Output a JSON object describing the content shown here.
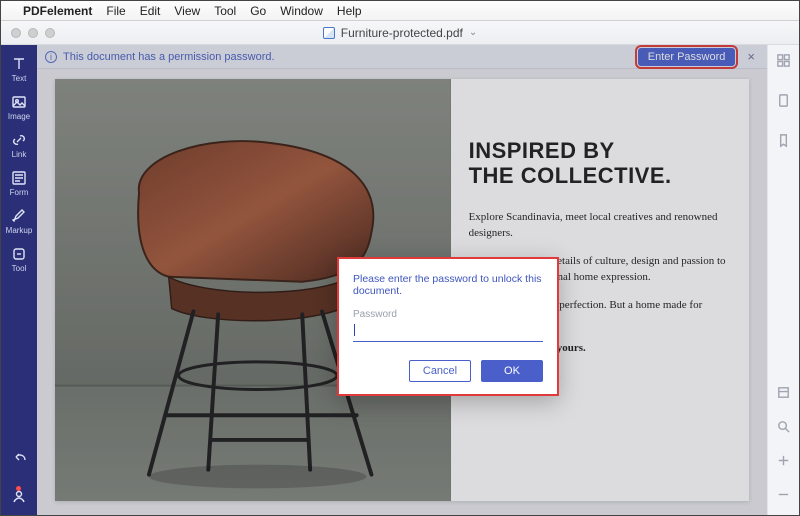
{
  "mac_menu": {
    "app": "PDFelement",
    "items": [
      "File",
      "Edit",
      "View",
      "Tool",
      "Go",
      "Window",
      "Help"
    ]
  },
  "window": {
    "doc_title": "Furniture-protected.pdf"
  },
  "sidebar": {
    "tools": [
      {
        "label": "Text",
        "icon": "text-icon"
      },
      {
        "label": "Image",
        "icon": "image-icon"
      },
      {
        "label": "Link",
        "icon": "link-icon"
      },
      {
        "label": "Form",
        "icon": "form-icon"
      },
      {
        "label": "Markup",
        "icon": "markup-icon"
      },
      {
        "label": "Tool",
        "icon": "tool-icon"
      }
    ]
  },
  "banner": {
    "message": "This document has a permission password.",
    "enter_password": "Enter Password"
  },
  "document": {
    "heading_line1": "INSPIRED BY",
    "heading_line2": "THE COLLECTIVE.",
    "para1": "Explore Scandinavia, meet local creatives and renowned designers.",
    "para2": "Be inspired by the details of culture, design and passion to find your own personal home expression.",
    "para3": "Not a space built on perfection. But a home made for living.",
    "signoff": "From our home to yours."
  },
  "dialog": {
    "title": "Please enter the password to unlock this document.",
    "label": "Password",
    "value": "",
    "cancel": "Cancel",
    "ok": "OK"
  }
}
